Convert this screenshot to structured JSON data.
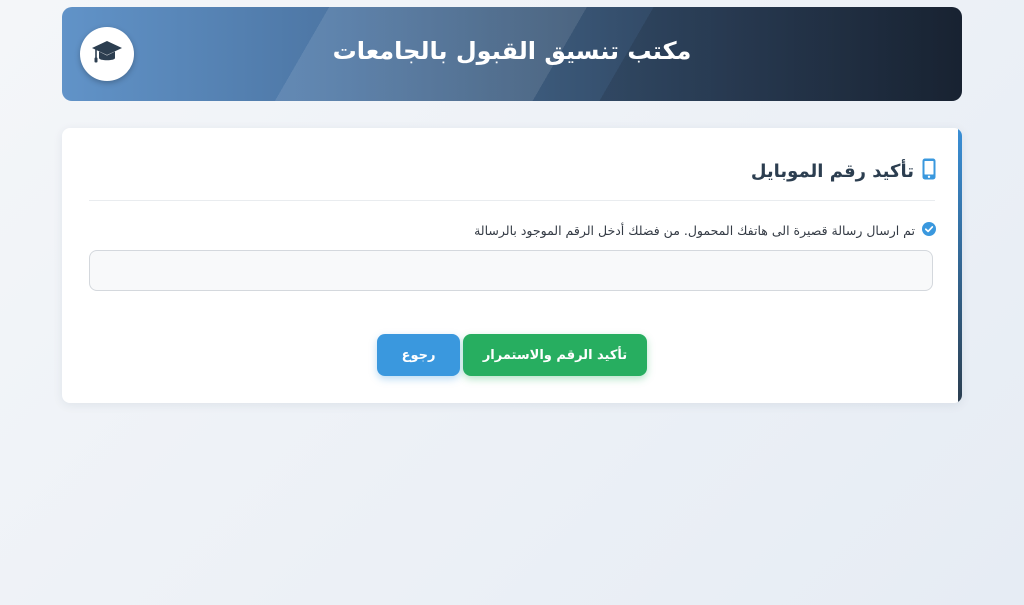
{
  "header": {
    "title": "مكتب تنسيق القبول بالجامعات",
    "logo_icon": "graduation-cap-icon"
  },
  "card": {
    "title": "تأكيد رقم الموبايل",
    "title_icon": "mobile-phone-icon",
    "info_icon": "check-circle-icon",
    "info_text": "تم ارسال رسالة قصيرة الى هاتفك المحمول. من فضلك أدخل الرقم الموجود بالرسالة",
    "code_input": {
      "value": "",
      "placeholder": ""
    },
    "confirm_button": "تأكيد الرقم والاستمرار",
    "back_button": "رجوع"
  },
  "colors": {
    "primary_blue": "#3a98de",
    "success_green": "#27ae60",
    "dark_navy": "#2c3e50"
  }
}
